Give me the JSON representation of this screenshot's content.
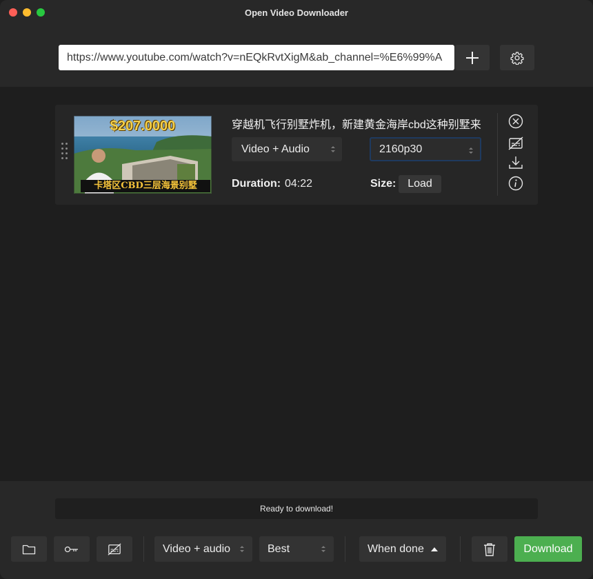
{
  "window": {
    "title": "Open Video Downloader"
  },
  "url_bar": {
    "value": "https://www.youtube.com/watch?v=nEQkRvtXigM&ab_channel=%E6%99%A",
    "add_icon": "plus-icon",
    "settings_icon": "gear-icon"
  },
  "video": {
    "title": "穿越机飞行别墅炸机，新建黄金海岸cbd这种别墅来",
    "thumbnail": {
      "price_text": "$207.0000",
      "caption_text": "卡塔区CBD三层海景别墅"
    },
    "type_select": "Video + Audio",
    "resolution_select": "2160p30",
    "duration_label": "Duration:",
    "duration_value": "04:22",
    "size_label": "Size:",
    "load_label": "Load",
    "side_icons": [
      "close-circle-icon",
      "no-subtitles-icon",
      "download-icon",
      "info-icon"
    ]
  },
  "footer": {
    "status": "Ready to download!",
    "type_select": "Video + audio",
    "quality_select": "Best",
    "when_done": "When done",
    "download_label": "Download",
    "icons": [
      "folder-icon",
      "key-icon",
      "no-subtitles-icon",
      "trash-icon"
    ],
    "download_color": "#4caf50"
  }
}
